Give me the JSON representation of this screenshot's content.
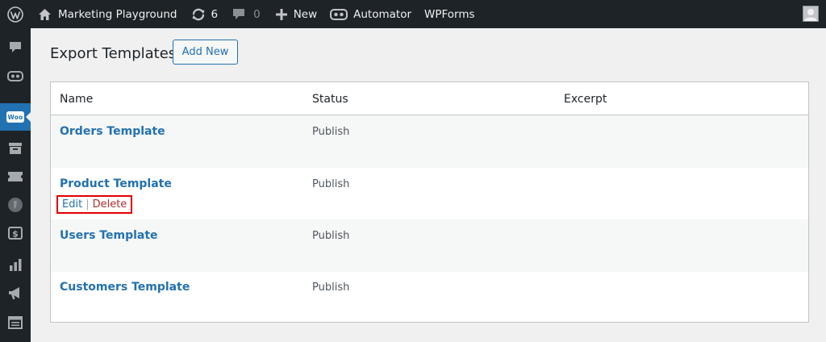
{
  "admin_bar": {
    "site_name": "Marketing Playground",
    "updates_count": "6",
    "comments_count": "0",
    "new_label": "New",
    "automator_label": "Automator",
    "wpforms_label": "WPForms"
  },
  "sidebar": {
    "items": [
      {
        "icon": "comments-icon"
      },
      {
        "icon": "automator-icon"
      },
      {
        "icon": "woocommerce-icon",
        "label": "Woo",
        "active": true
      },
      {
        "icon": "archive-icon"
      },
      {
        "icon": "ticket-icon"
      },
      {
        "icon": "avatar-icon"
      },
      {
        "icon": "dollar-icon"
      },
      {
        "icon": "analytics-icon"
      },
      {
        "icon": "megaphone-icon"
      },
      {
        "icon": "calendar-icon"
      }
    ]
  },
  "page": {
    "title": "Export Templates",
    "add_new_label": "Add New"
  },
  "table": {
    "columns": [
      "Name",
      "Status",
      "Excerpt"
    ],
    "rows": [
      {
        "name": "Orders Template",
        "status": "Publish",
        "excerpt": ""
      },
      {
        "name": "Product Template",
        "status": "Publish",
        "excerpt": ""
      },
      {
        "name": "Users Template",
        "status": "Publish",
        "excerpt": ""
      },
      {
        "name": "Customers Template",
        "status": "Publish",
        "excerpt": ""
      }
    ],
    "row_actions": {
      "edit": "Edit",
      "separator": "|",
      "delete": "Delete"
    }
  },
  "colors": {
    "admin_bar_bg": "#1d2327",
    "accent": "#2271b1",
    "delete": "#b32d2e",
    "highlight_box": "#e00000"
  }
}
